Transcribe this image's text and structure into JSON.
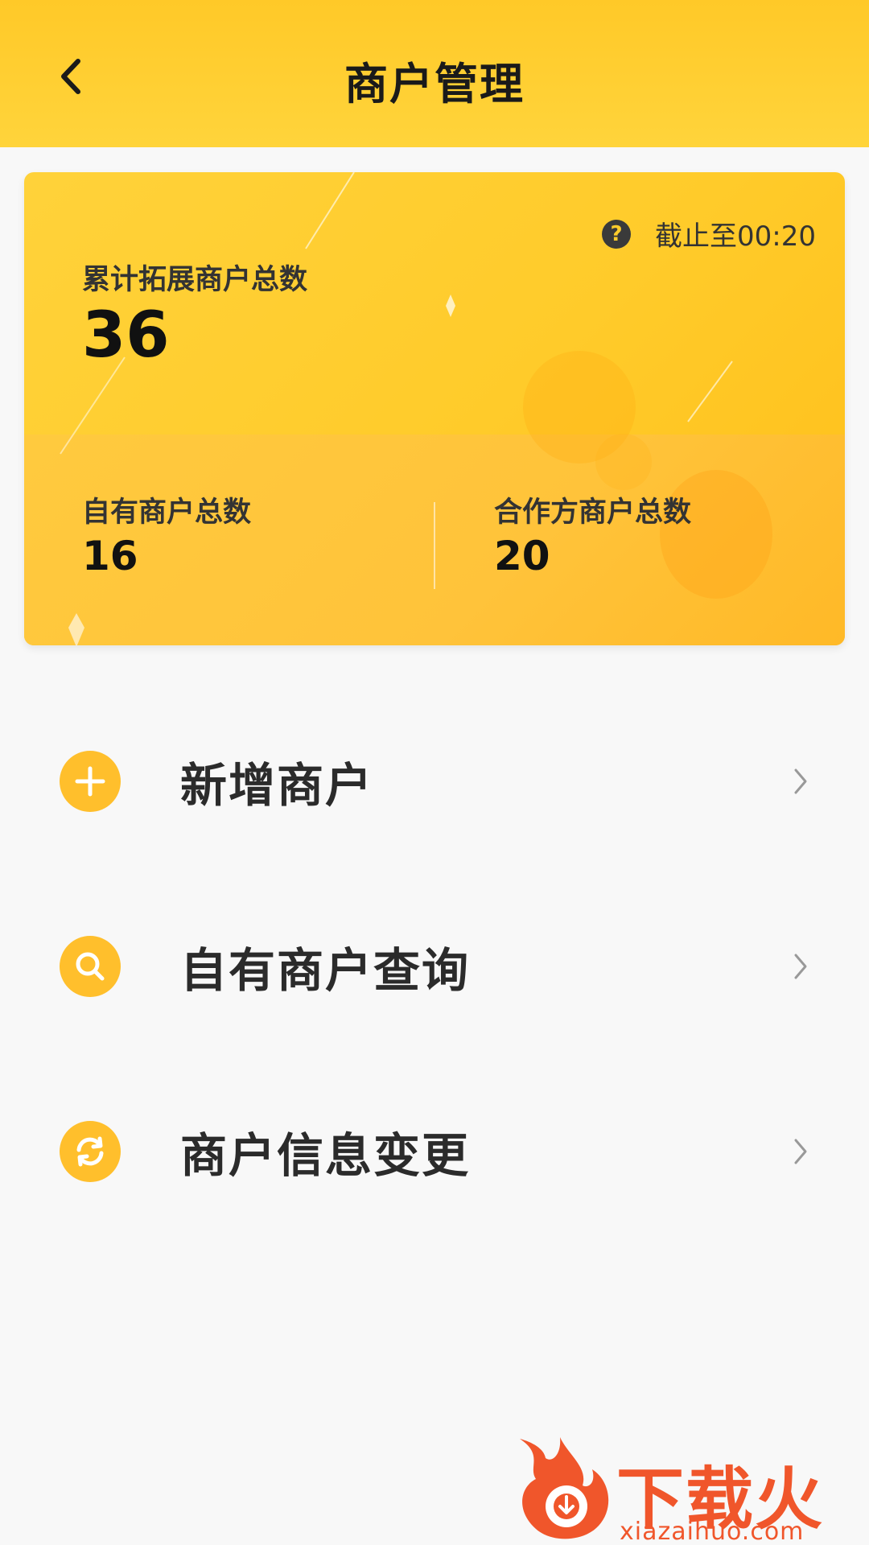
{
  "header": {
    "title": "商户管理",
    "back_icon": "chevron-left-icon"
  },
  "summary": {
    "as_of": "截止至00:20",
    "help_icon": "question-icon",
    "total_label": "累计拓展商户总数",
    "total_value": "36",
    "own_label": "自有商户总数",
    "own_value": "16",
    "partner_label": "合作方商户总数",
    "partner_value": "20"
  },
  "menu": {
    "items": [
      {
        "label": "新增商户",
        "icon": "plus-icon"
      },
      {
        "label": "自有商户查询",
        "icon": "search-icon"
      },
      {
        "label": "商户信息变更",
        "icon": "refresh-icon"
      }
    ]
  },
  "watermark": {
    "brand": "下载火",
    "url": "xiazaihuo.com"
  },
  "colors": {
    "header_bg": "#ffcb2e",
    "card_bg": "#ffc928",
    "icon_bg": "#ffbf2c",
    "watermark": "#f0562b"
  }
}
